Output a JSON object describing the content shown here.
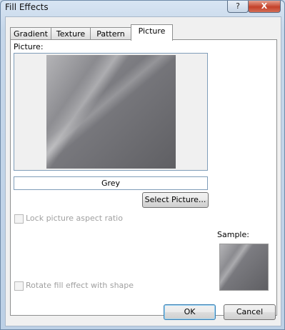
{
  "window": {
    "title": "Fill Effects",
    "help_label": "?",
    "close_label": "X"
  },
  "tabs": [
    {
      "label": "Gradient"
    },
    {
      "label": "Texture"
    },
    {
      "label": "Pattern"
    },
    {
      "label": "Picture",
      "active": true
    }
  ],
  "picture": {
    "label": "Picture:",
    "name": "Grey",
    "select_button": "Select Picture..."
  },
  "options": {
    "lock_aspect": {
      "label": "Lock picture aspect ratio",
      "checked": false,
      "enabled": false
    },
    "rotate_fill": {
      "label": "Rotate fill effect with shape",
      "checked": false,
      "enabled": false
    }
  },
  "sample": {
    "label": "Sample:"
  },
  "buttons": {
    "ok": "OK",
    "cancel": "Cancel"
  }
}
